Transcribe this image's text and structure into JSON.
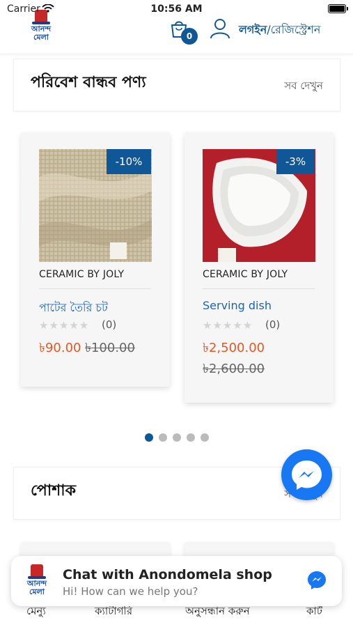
{
  "status_bar": {
    "carrier": "Carrier",
    "time": "10:56 AM"
  },
  "header": {
    "logo_text": "আনন্দ মেলা",
    "cart_count": "0",
    "login_label": "লগইন",
    "login_separator": "/",
    "register_label": "রেজিস্ট্রেশন"
  },
  "section_eco": {
    "title": "পরিবেশ বান্ধব পণ্য",
    "view_all": "সব দেখুন"
  },
  "products": [
    {
      "discount": "-10%",
      "brand": "CERAMIC BY JOLY",
      "name": "পাটের তৈরি চট",
      "rating_count": "(0)",
      "price": "৳90.00",
      "old_price": "৳100.00",
      "image": "jute-fabric"
    },
    {
      "discount": "-3%",
      "brand": "CERAMIC BY JOLY",
      "name": "Serving dish",
      "rating_count": "(0)",
      "price": "৳2,500.00",
      "old_price": "৳2,600.00",
      "image": "ceramic-dish"
    }
  ],
  "carousel": {
    "pages": 5,
    "active": 0
  },
  "section_clothing": {
    "title": "পোশাক",
    "view_all": "সব দেখুন"
  },
  "chat": {
    "title": "Chat with Anondomela shop",
    "subtitle": "Hi! How can we help you?",
    "logo_text": "আনন্দ মেলা"
  },
  "bottom_nav": {
    "menu": "মেন্যু",
    "category": "ক্যাটাগরি",
    "search": "অনুসন্ধান করুন",
    "cart": "কার্ট"
  },
  "colors": {
    "brand": "#0f5796",
    "price": "#e65722",
    "link": "#1565c0",
    "messenger": "#1877f2"
  }
}
